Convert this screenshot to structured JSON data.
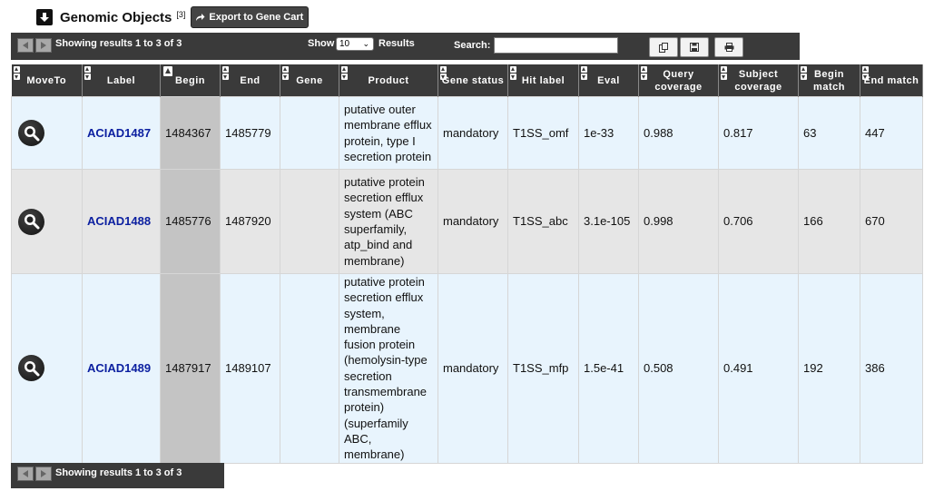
{
  "header": {
    "title": "Genomic Objects",
    "count": "[3]",
    "export_label": "Export to Gene Cart"
  },
  "toolbar": {
    "status": "Showing results 1 to 3 of 3",
    "show_label": "Show",
    "page_size": "10",
    "results_label": "Results",
    "search_label": "Search:",
    "search_value": ""
  },
  "columns": [
    {
      "label": "MoveTo"
    },
    {
      "label": "Label"
    },
    {
      "label": "Begin"
    },
    {
      "label": "End"
    },
    {
      "label": "Gene"
    },
    {
      "label": "Product"
    },
    {
      "label": "Gene status"
    },
    {
      "label": "Hit label"
    },
    {
      "label": "Eval"
    },
    {
      "label": "Query coverage"
    },
    {
      "label": "Subject coverage"
    },
    {
      "label": "Begin match"
    },
    {
      "label": "End match"
    }
  ],
  "rows": [
    {
      "label": "ACIAD1487",
      "begin": "1484367",
      "end": "1485779",
      "gene": "",
      "product": "putative outer membrane efflux protein, type I secretion protein",
      "gene_status": "mandatory",
      "hit_label": "T1SS_omf",
      "eval": "1e-33",
      "query_coverage": "0.988",
      "subject_coverage": "0.817",
      "begin_match": "63",
      "end_match": "447"
    },
    {
      "label": "ACIAD1488",
      "begin": "1485776",
      "end": "1487920",
      "gene": "",
      "product": "putative protein secretion efflux system (ABC superfamily, atp_bind and membrane)",
      "gene_status": "mandatory",
      "hit_label": "T1SS_abc",
      "eval": "3.1e-105",
      "query_coverage": "0.998",
      "subject_coverage": "0.706",
      "begin_match": "166",
      "end_match": "670"
    },
    {
      "label": "ACIAD1489",
      "begin": "1487917",
      "end": "1489107",
      "gene": "",
      "product": "putative protein secretion efflux system, membrane fusion protein (hemolysin-type secretion transmembrane protein) (superfamily ABC, membrane)",
      "gene_status": "mandatory",
      "hit_label": "T1SS_mfp",
      "eval": "1.5e-41",
      "query_coverage": "0.508",
      "subject_coverage": "0.491",
      "begin_match": "192",
      "end_match": "386"
    }
  ],
  "footer": {
    "status": "Showing results 1 to 3 of 3"
  }
}
